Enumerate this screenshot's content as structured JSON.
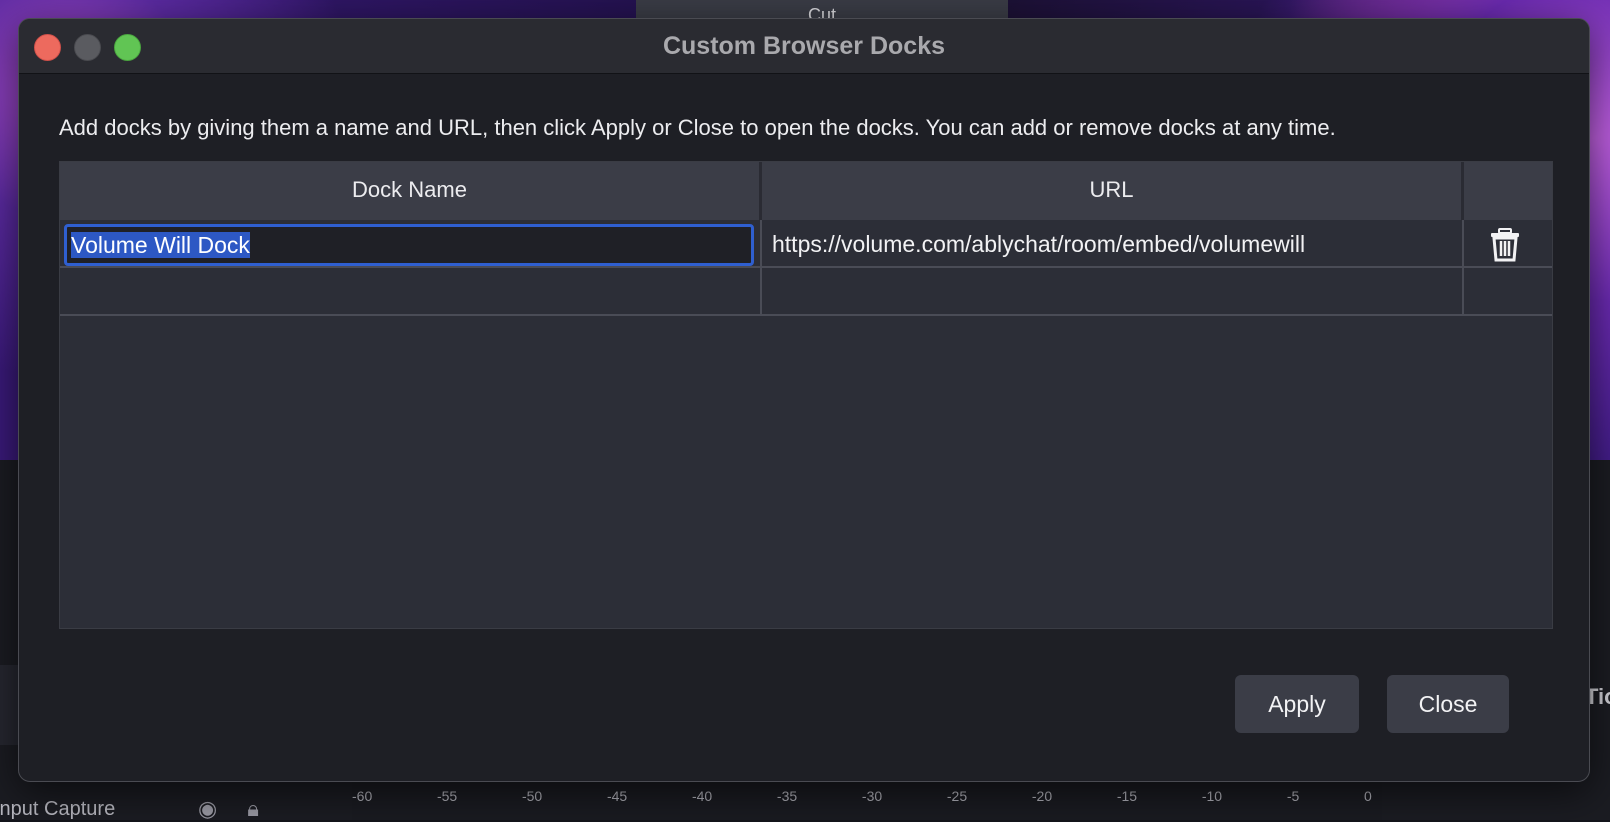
{
  "background": {
    "top_button_label": "Cut",
    "left_panel_label": "Input Capture",
    "right_panel_label": "Tio",
    "meter_ticks": [
      "-60",
      "-55",
      "-50",
      "-45",
      "-40",
      "-35",
      "-30",
      "-25",
      "-20",
      "-15",
      "-10",
      "-5",
      "0"
    ]
  },
  "dialog": {
    "title": "Custom Browser Docks",
    "description": "Add docks by giving them a name and URL, then click Apply or Close to open the docks. You can add or remove docks at any time.",
    "table": {
      "headers": {
        "name": "Dock Name",
        "url": "URL",
        "actions": ""
      },
      "rows": [
        {
          "name": "Volume Will Dock",
          "url": "https://volume.com/ablychat/room/embed/volumewill",
          "delete_icon": "trash-icon"
        },
        {
          "name": "",
          "url": ""
        }
      ]
    },
    "buttons": {
      "apply": "Apply",
      "close": "Close"
    },
    "colors": {
      "selection": "#2d58c4",
      "focus_border": "#2f5fd0",
      "close_light": "#ed6a5e",
      "zoom_light": "#61c554"
    }
  }
}
